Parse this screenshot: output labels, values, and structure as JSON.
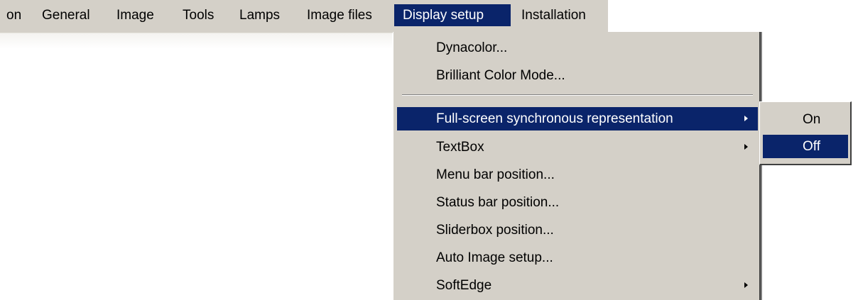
{
  "menubar": {
    "items": [
      {
        "label": "on"
      },
      {
        "label": "General"
      },
      {
        "label": "Image"
      },
      {
        "label": "Tools"
      },
      {
        "label": "Lamps"
      },
      {
        "label": "Image files"
      },
      {
        "label": "Display setup"
      },
      {
        "label": "Installation"
      }
    ]
  },
  "dropdown": {
    "items": [
      {
        "label": "Dynacolor..."
      },
      {
        "label": "Brilliant Color Mode..."
      },
      {
        "label": "Full-screen synchronous representation"
      },
      {
        "label": "TextBox"
      },
      {
        "label": "Menu bar position..."
      },
      {
        "label": "Status bar position..."
      },
      {
        "label": "Sliderbox position..."
      },
      {
        "label": "Auto Image setup..."
      },
      {
        "label": "SoftEdge"
      }
    ]
  },
  "submenu": {
    "items": [
      {
        "label": "On"
      },
      {
        "label": "Off"
      }
    ]
  },
  "colors": {
    "menu_background": "#d4d0c8",
    "highlight": "#0a246a",
    "highlight_text": "#ffffff"
  },
  "icons": {
    "submenu_arrow": "triangle-right-icon"
  }
}
